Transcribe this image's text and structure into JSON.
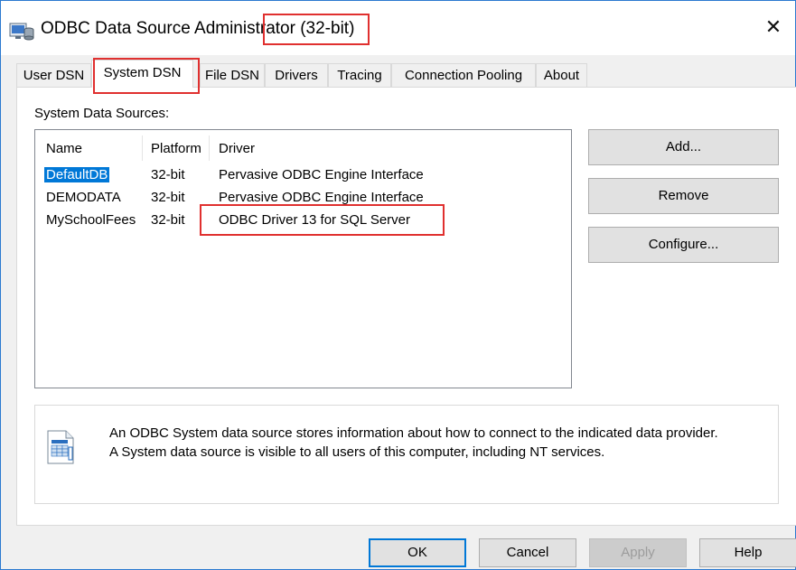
{
  "window": {
    "title": "ODBC Data Source Administrator (32-bit)",
    "close_glyph": "✕",
    "app_icon": "odbc-admin-icon"
  },
  "tabs": [
    {
      "label": "User DSN",
      "active": false
    },
    {
      "label": "System DSN",
      "active": true
    },
    {
      "label": "File DSN",
      "active": false
    },
    {
      "label": "Drivers",
      "active": false
    },
    {
      "label": "Tracing",
      "active": false
    },
    {
      "label": "Connection Pooling",
      "active": false
    },
    {
      "label": "About",
      "active": false
    }
  ],
  "system_dsn": {
    "group_label": "System Data Sources:",
    "columns": [
      "Name",
      "Platform",
      "Driver"
    ],
    "rows": [
      {
        "name": "DefaultDB",
        "platform": "32-bit",
        "driver": "Pervasive ODBC Engine Interface",
        "selected": true
      },
      {
        "name": "DEMODATA",
        "platform": "32-bit",
        "driver": "Pervasive ODBC Engine Interface",
        "selected": false
      },
      {
        "name": "MySchoolFees",
        "platform": "32-bit",
        "driver": "ODBC Driver 13 for SQL Server",
        "selected": false
      }
    ],
    "buttons": {
      "add": "Add...",
      "remove": "Remove",
      "configure": "Configure..."
    },
    "info": {
      "line1": "An ODBC System data source stores information about how to connect to the indicated data provider.",
      "line2": "A System data source is visible to all users of this computer, including NT services.",
      "icon": "data-source-icon"
    }
  },
  "footer": {
    "ok": "OK",
    "cancel": "Cancel",
    "apply": "Apply",
    "help": "Help"
  },
  "colors": {
    "selection": "#0078d7",
    "annotation": "#e0302f",
    "window_border": "#2b79d0"
  }
}
